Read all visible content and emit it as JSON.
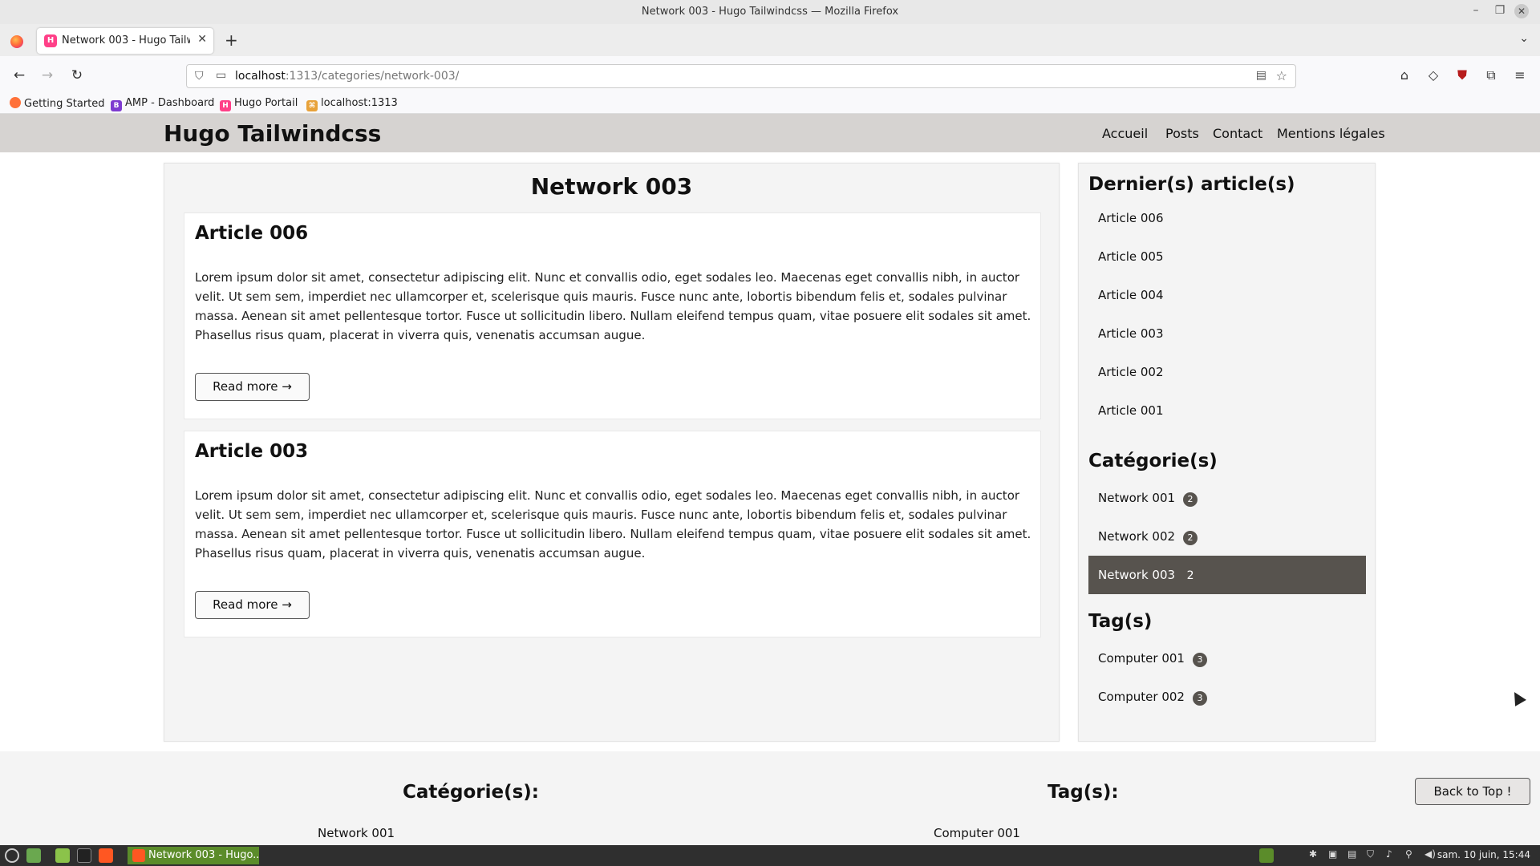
{
  "window": {
    "title": "Network 003 - Hugo Tailwindcss — Mozilla Firefox",
    "minimize": "–",
    "restore": "❐",
    "close": "✕"
  },
  "browser": {
    "tab_title": "Network 003 - Hugo Tailwindcss",
    "tab_favicon": "H",
    "tab_close": "✕",
    "new_tab": "+",
    "tab_list": "⌄",
    "url_host": "localhost",
    "url_rest": ":1313/categories/network-003/",
    "toolbar": {
      "back": "←",
      "forward": "→",
      "reload": "↻",
      "shield": "⛉",
      "page": "▭",
      "reader": "▤",
      "star": "☆",
      "home": "⌂",
      "pocket": "◇",
      "ublock": "⛊",
      "extensions": "⧉",
      "menu": "≡"
    },
    "bookmarks": [
      {
        "label": "Getting Started",
        "icon": "firefox-icon",
        "color": "#ff7139",
        "glyph": ""
      },
      {
        "label": "AMP - Dashboard",
        "icon": "amp-icon",
        "color": "#7e3bd0",
        "glyph": "B"
      },
      {
        "label": "Hugo Portail",
        "icon": "hugo-icon",
        "color": "#ff4088",
        "glyph": "H"
      },
      {
        "label": "localhost:1313",
        "icon": "localhost-icon",
        "color": "#e8a23a",
        "glyph": "⌘"
      }
    ]
  },
  "site": {
    "brand": "Hugo Tailwindcss",
    "nav": [
      "Accueil",
      "Posts",
      "Contact",
      "Mentions légales"
    ]
  },
  "main": {
    "title": "Network 003",
    "articles": [
      {
        "title": "Article 006",
        "excerpt": "Lorem ipsum dolor sit amet, consectetur adipiscing elit. Nunc et convallis odio, eget sodales leo. Maecenas eget convallis nibh, in auctor velit. Ut sem sem, imperdiet nec ullamcorper et, scelerisque quis mauris. Fusce nunc ante, lobortis bibendum felis et, sodales pulvinar massa. Aenean sit amet pellentesque tortor. Fusce ut sollicitudin libero. Nullam eleifend tempus quam, vitae posuere elit sodales sit amet. Phasellus risus quam, placerat in viverra quis, venenatis accumsan augue.",
        "read_more": "Read more →"
      },
      {
        "title": "Article 003",
        "excerpt": "Lorem ipsum dolor sit amet, consectetur adipiscing elit. Nunc et convallis odio, eget sodales leo. Maecenas eget convallis nibh, in auctor velit. Ut sem sem, imperdiet nec ullamcorper et, scelerisque quis mauris. Fusce nunc ante, lobortis bibendum felis et, sodales pulvinar massa. Aenean sit amet pellentesque tortor. Fusce ut sollicitudin libero. Nullam eleifend tempus quam, vitae posuere elit sodales sit amet. Phasellus risus quam, placerat in viverra quis, venenatis accumsan augue.",
        "read_more": "Read more →"
      }
    ]
  },
  "sidebar": {
    "latest_heading": "Dernier(s) article(s)",
    "latest": [
      "Article 006",
      "Article 005",
      "Article 004",
      "Article 003",
      "Article 002",
      "Article 001"
    ],
    "categories_heading": "Catégorie(s)",
    "categories": [
      {
        "label": "Network 001",
        "count": "2",
        "active": false
      },
      {
        "label": "Network 002",
        "count": "2",
        "active": false
      },
      {
        "label": "Network 003",
        "count": "2",
        "active": true
      }
    ],
    "tags_heading": "Tag(s)",
    "tags": [
      {
        "label": "Computer 001",
        "count": "3"
      },
      {
        "label": "Computer 002",
        "count": "3"
      }
    ]
  },
  "footer": {
    "categories_heading": "Catégorie(s):",
    "first_category": "Network 001",
    "tags_heading": "Tag(s):",
    "first_tag": "Computer 001",
    "back_to_top": "Back to Top !"
  },
  "taskbar": {
    "active_task": "Network 003 - Hugo...",
    "clock": "sam. 10 juin, 15:44"
  },
  "colors": {
    "header_bg": "#d6d3d1",
    "active_item_bg": "#57534e",
    "panel_bg": "#f4f4f4",
    "taskbar_bg": "#2f2f2f",
    "taskbar_active": "#5b8c2a"
  }
}
